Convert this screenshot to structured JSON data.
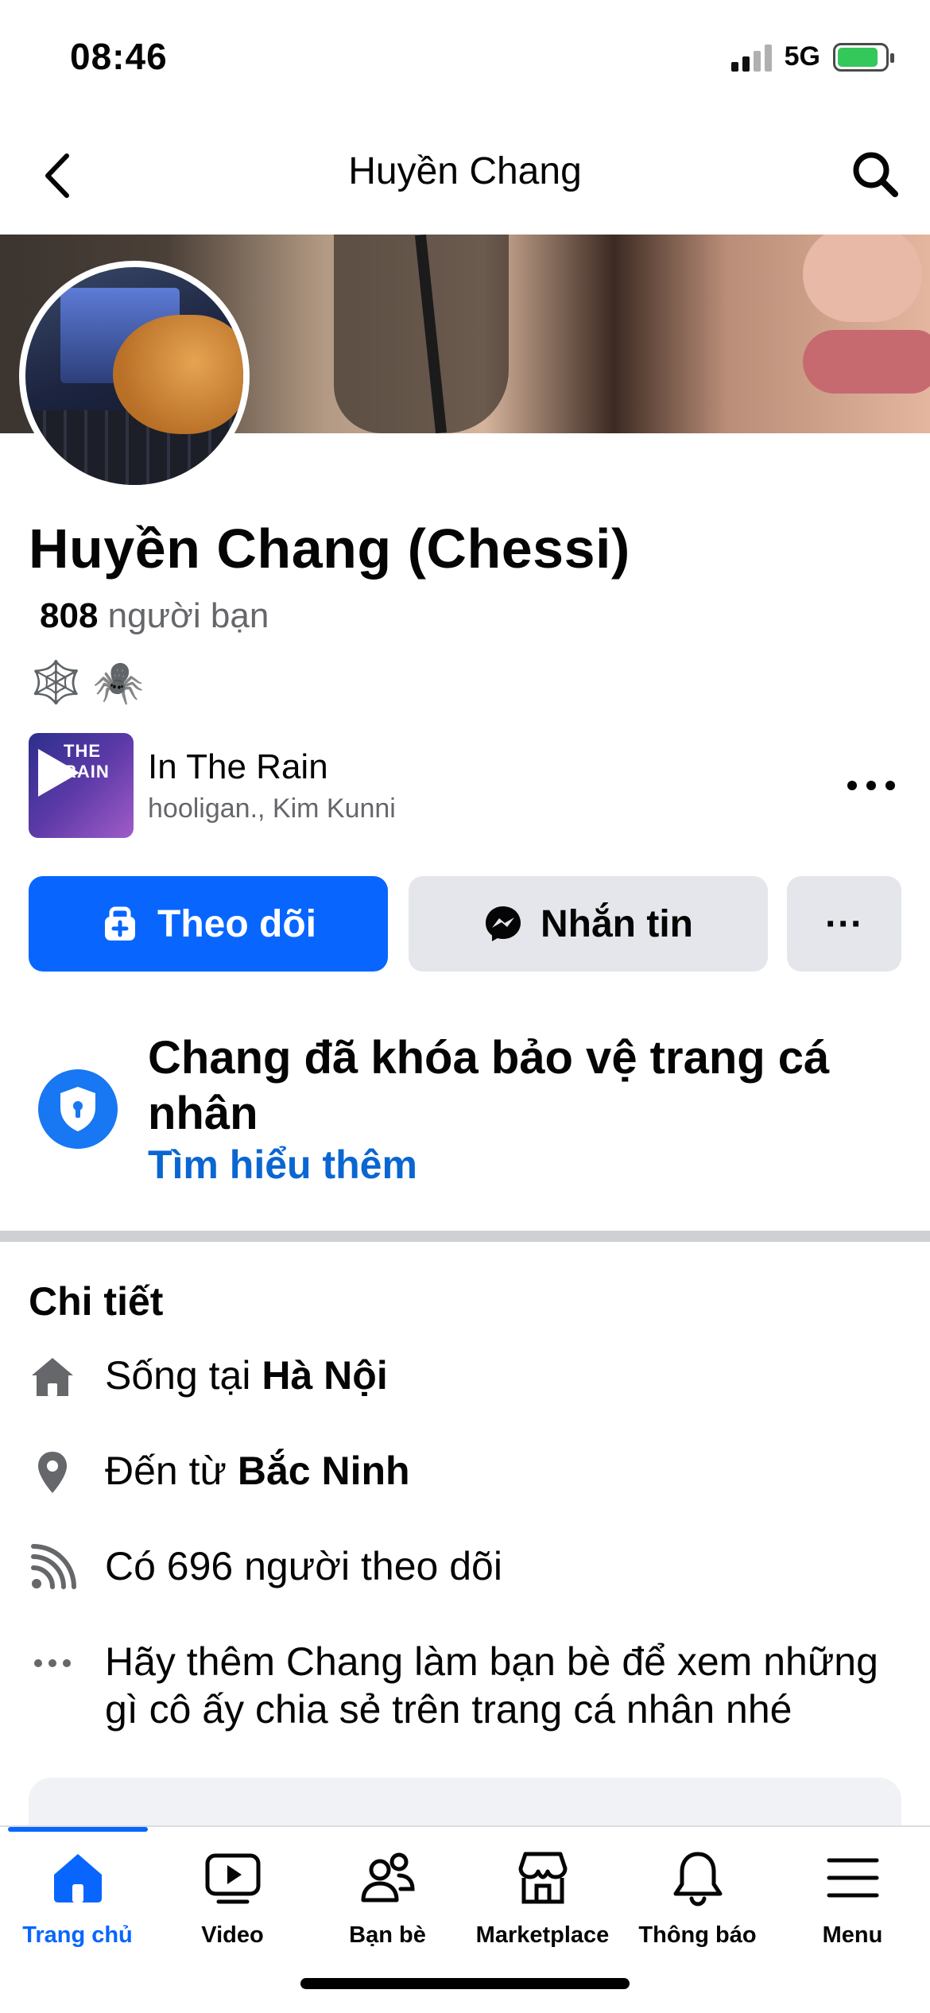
{
  "status_bar": {
    "time": "08:46",
    "network": "5G",
    "signal_bars_on": 2,
    "signal_bars_total": 4,
    "battery_charging": true
  },
  "nav": {
    "back_icon": "chevron-left-icon",
    "title": "Huyền Chang",
    "search_icon": "search-icon"
  },
  "profile": {
    "name": "Huyền Chang (Chessi)",
    "friends_count": "808",
    "friends_label": "người bạn",
    "emojis": [
      "🕸️",
      "🕷️"
    ]
  },
  "music": {
    "title": "In The Rain",
    "artist": "hooligan., Kim Kunni",
    "cover_text": "THE RAIN"
  },
  "actions": {
    "follow_label": "Theo dõi",
    "message_label": "Nhắn tin",
    "more_label": "···"
  },
  "lock_notice": {
    "title": "Chang đã khóa bảo vệ trang cá nhân",
    "link": "Tìm hiểu thêm"
  },
  "details": {
    "title": "Chi tiết",
    "lives_prefix": "Sống tại ",
    "lives_place": "Hà Nội",
    "from_prefix": "Đến từ ",
    "from_place": "Bắc Ninh",
    "followers": "Có 696 người theo dõi",
    "add_friend_hint": "Hãy thêm Chang làm bạn bè để xem những gì cô ấy chia sẻ trên trang cá nhân nhé"
  },
  "tabs": [
    {
      "label": "Trang chủ",
      "icon": "home-icon",
      "active": true
    },
    {
      "label": "Video",
      "icon": "video-icon",
      "active": false
    },
    {
      "label": "Bạn bè",
      "icon": "friends-icon",
      "active": false
    },
    {
      "label": "Marketplace",
      "icon": "marketplace-icon",
      "active": false
    },
    {
      "label": "Thông báo",
      "icon": "bell-icon",
      "active": false
    },
    {
      "label": "Menu",
      "icon": "menu-icon",
      "active": false
    }
  ],
  "colors": {
    "accent": "#0866ff",
    "link": "#0a66d2",
    "secondary_button": "#e4e6eb",
    "secondary_text": "#65676b"
  }
}
